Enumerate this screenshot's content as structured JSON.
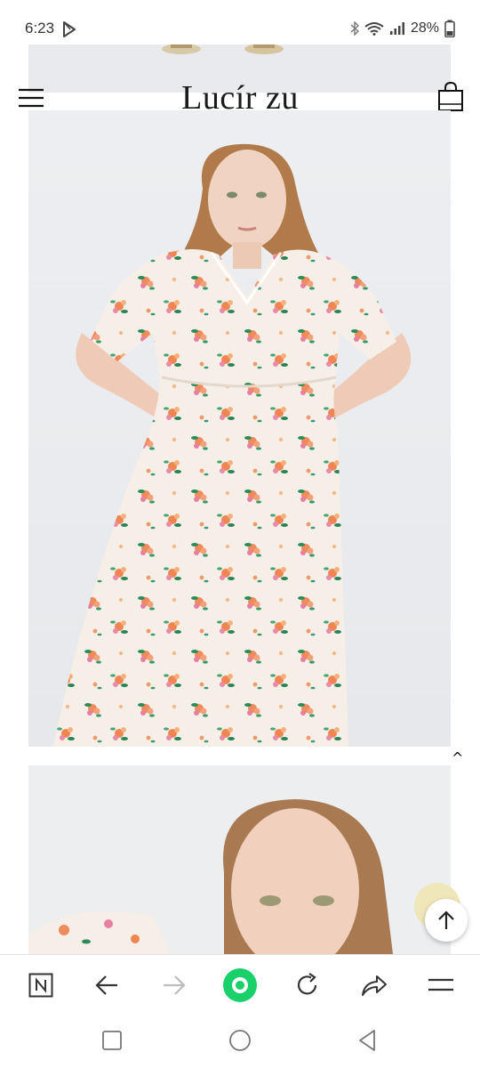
{
  "status_bar": {
    "time": "6:23",
    "battery": "28%",
    "icons": [
      "play-store-icon",
      "bluetooth-icon",
      "wifi-icon",
      "signal-icon",
      "battery-icon"
    ]
  },
  "header": {
    "brand": "Lucír zu",
    "icons": [
      "hamburger-menu-icon",
      "shopping-bag-icon"
    ]
  },
  "gallery": {
    "images": [
      "top-cropped-photo",
      "main-floral-dress-photo",
      "second-closeup-photo"
    ],
    "scroll_up_caret": "^"
  },
  "floating": {
    "icons": [
      "chat-icon",
      "arrow-up-icon"
    ]
  },
  "browser_bar": {
    "icons": [
      "n-tab-icon",
      "back-arrow-icon",
      "forward-arrow-icon",
      "green-home-icon",
      "reload-icon",
      "share-icon",
      "browser-menu-icon"
    ],
    "accent": "#19d06a"
  },
  "nav_bar": {
    "icons": [
      "recent-apps-icon",
      "home-icon",
      "back-icon"
    ]
  }
}
